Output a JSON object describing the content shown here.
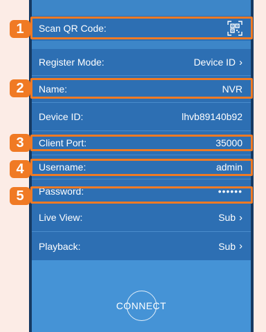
{
  "form": {
    "scan_qr": {
      "label": "Scan QR Code:",
      "icon": "qr-code-icon"
    },
    "register_mode": {
      "label": "Register Mode:",
      "value": "Device ID",
      "icon": "chevron-right-icon"
    },
    "name": {
      "label": "Name:",
      "value": "NVR"
    },
    "device_id": {
      "label": "Device ID:",
      "value": "lhvb89140b92"
    },
    "client_port": {
      "label": "Client Port:",
      "value": "35000"
    },
    "username": {
      "label": "Username:",
      "value": "admin"
    },
    "password": {
      "label": "Password:",
      "value": "••••••"
    },
    "live_view": {
      "label": "Live View:",
      "value": "Sub",
      "icon": "chevron-right-icon"
    },
    "playback": {
      "label": "Playback:",
      "value": "Sub",
      "icon": "chevron-right-icon"
    }
  },
  "connect_label": "CONNECT",
  "callouts": [
    "1",
    "2",
    "3",
    "4",
    "5"
  ],
  "colors": {
    "background": "#fcece6",
    "row": "#2d6fb3",
    "highlight": "#f07a24",
    "frame": "#163a63"
  }
}
